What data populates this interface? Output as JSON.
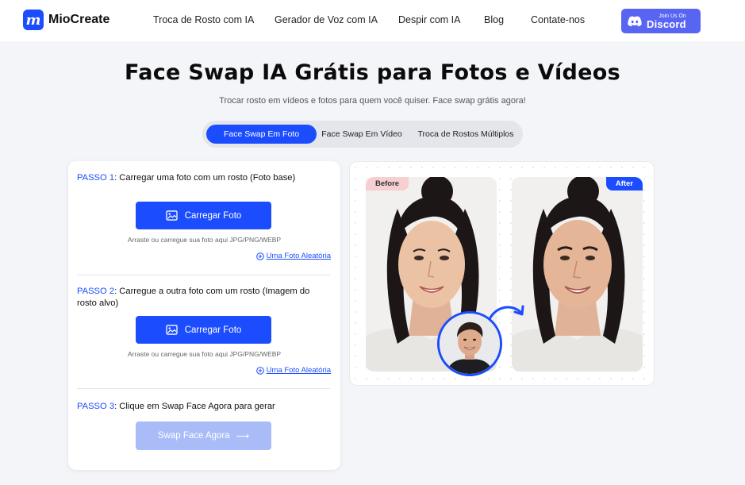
{
  "header": {
    "logo_text": "MioCreate",
    "logo_letter": "m",
    "nav": [
      "Troca de Rosto com IA",
      "Gerador de Voz com IA",
      "Despir com IA",
      "Blog",
      "Contate-nos"
    ],
    "discord_small": "Join Us On",
    "discord_big": "Discord"
  },
  "hero": {
    "title": "Face Swap IA Grátis para Fotos e Vídeos",
    "subtitle": "Trocar rosto em vídeos e fotos para quem você quiser. Face swap grátis agora!"
  },
  "tabs": [
    "Face Swap Em Foto",
    "Face Swap Em Vídeo",
    "Troca de Rostos Múltiplos"
  ],
  "steps": [
    {
      "num": "PASSO 1",
      "text": ": Carregar uma foto com um rosto (Foto base)"
    },
    {
      "num": "PASSO 2",
      "text": ": Carregue a outra foto com um rosto (Imagem do rosto alvo)"
    },
    {
      "num": "PASSO 3",
      "text": ": Clique em Swap Face Agora para gerar"
    }
  ],
  "upload_label": "Carregar Foto",
  "upload_hint": "Arraste ou carregue sua foto aqui JPG/PNG/WEBP",
  "random_link": "Uma Foto Aleatória",
  "swap_button": "Swap Face Agora",
  "swap_arrow": "⟶",
  "preview": {
    "before": "Before",
    "after": "After"
  },
  "colors": {
    "accent": "#1b4dff",
    "discord": "#5865f2",
    "swap_disabled": "#a9bcf8",
    "before_badge": "#f6cfd0"
  },
  "icons": [
    "miocreate-logo",
    "discord-icon",
    "image-icon",
    "plus-circle-icon",
    "curved-arrow-icon"
  ]
}
